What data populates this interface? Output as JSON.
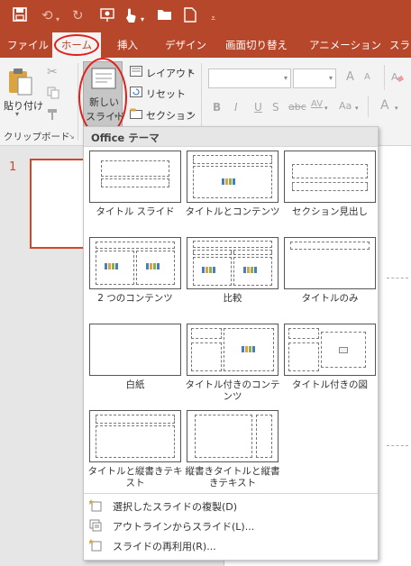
{
  "qat": {
    "icons": [
      "save-icon",
      "undo-icon",
      "redo-icon",
      "present-from-start-icon",
      "touch-mode-icon",
      "open-folder-icon",
      "new-file-icon",
      "customize-qat-icon"
    ]
  },
  "tabs": [
    {
      "id": "file",
      "label": "ファイル"
    },
    {
      "id": "home",
      "label": "ホーム"
    },
    {
      "id": "insert",
      "label": "挿入"
    },
    {
      "id": "design",
      "label": "デザイン"
    },
    {
      "id": "transitions",
      "label": "画面切り替え"
    },
    {
      "id": "animations",
      "label": "アニメーション"
    },
    {
      "id": "slideshow",
      "label": "スライ"
    }
  ],
  "ribbon": {
    "paste_label": "貼り付け",
    "clipboard_group_label": "クリップボード",
    "new_slide_line1": "新しい",
    "new_slide_line2": "スライド",
    "layout_label": "レイアウト",
    "reset_label": "リセット",
    "section_label": "セクション",
    "font_buttons": [
      "B",
      "I",
      "U",
      "S"
    ],
    "spacing_label": "AV",
    "case_label": "Aa",
    "font_color_label": "A"
  },
  "slides_pane": {
    "slide_number": "1"
  },
  "gallery": {
    "header": "Office テーマ",
    "layouts": [
      {
        "id": "title-slide",
        "label": "タイトル スライド"
      },
      {
        "id": "title-content",
        "label": "タイトルとコンテンツ"
      },
      {
        "id": "section-header",
        "label": "セクション見出し"
      },
      {
        "id": "two-content",
        "label": "2 つのコンテンツ"
      },
      {
        "id": "comparison",
        "label": "比較"
      },
      {
        "id": "title-only",
        "label": "タイトルのみ"
      },
      {
        "id": "blank",
        "label": "白紙"
      },
      {
        "id": "content-caption",
        "label": "タイトル付きのコンテンツ"
      },
      {
        "id": "picture-caption",
        "label": "タイトル付きの図"
      },
      {
        "id": "title-vertical-text",
        "label": "タイトルと縦書きテキスト"
      },
      {
        "id": "vertical-title-text",
        "label": "縦書きタイトルと縦書きテキスト"
      }
    ],
    "menu": [
      {
        "id": "duplicate-selected",
        "label": "選択したスライドの複製(D)"
      },
      {
        "id": "slides-from-outline",
        "label": "アウトラインからスライド(L)..."
      },
      {
        "id": "reuse-slides",
        "label": "スライドの再利用(R)..."
      }
    ]
  },
  "colors": {
    "accent": "#b7472a",
    "highlight_circle": "#e0201a",
    "slide_thumb_border": "#d24726"
  }
}
